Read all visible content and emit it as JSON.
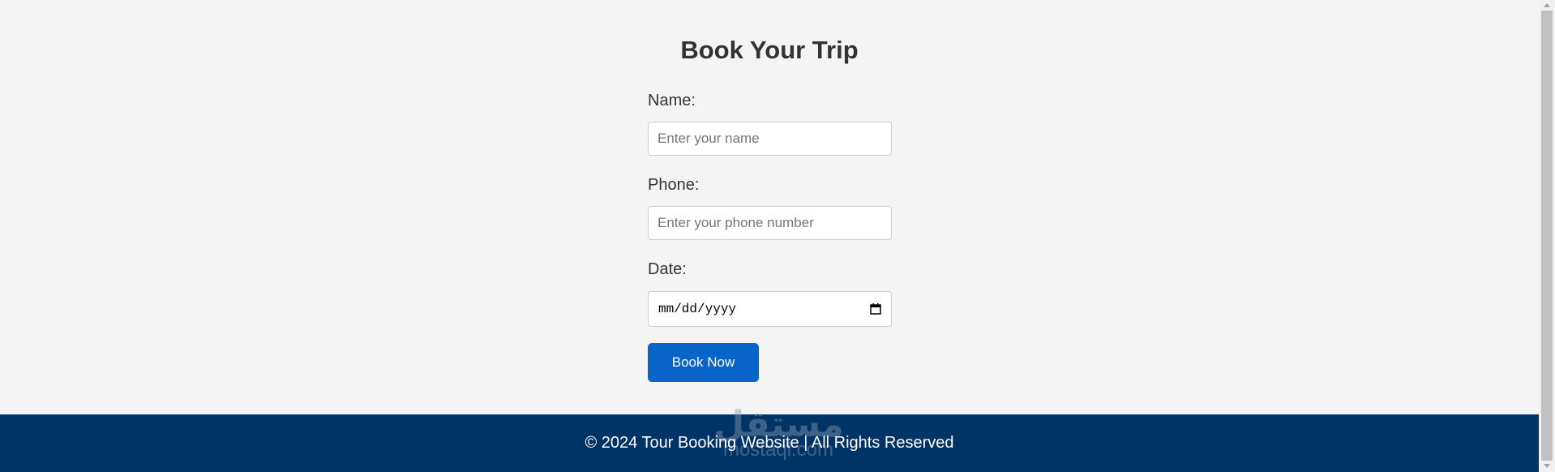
{
  "form": {
    "title": "Book Your Trip",
    "name_label": "Name:",
    "name_placeholder": "Enter your name",
    "phone_label": "Phone:",
    "phone_placeholder": "Enter your phone number",
    "date_label": "Date:",
    "date_placeholder": "mm/dd/yyyy",
    "submit_label": "Book Now"
  },
  "footer": {
    "text": "© 2024 Tour Booking Website | All Rights Reserved"
  },
  "watermark": {
    "arabic": "مستقل",
    "latin": "mostaql.com"
  },
  "icons": {
    "date_picker": "calendar-icon"
  },
  "colors": {
    "page_background": "#f4f4f4",
    "primary_button": "#0764c9",
    "footer_background": "#003366",
    "text": "#333333"
  }
}
